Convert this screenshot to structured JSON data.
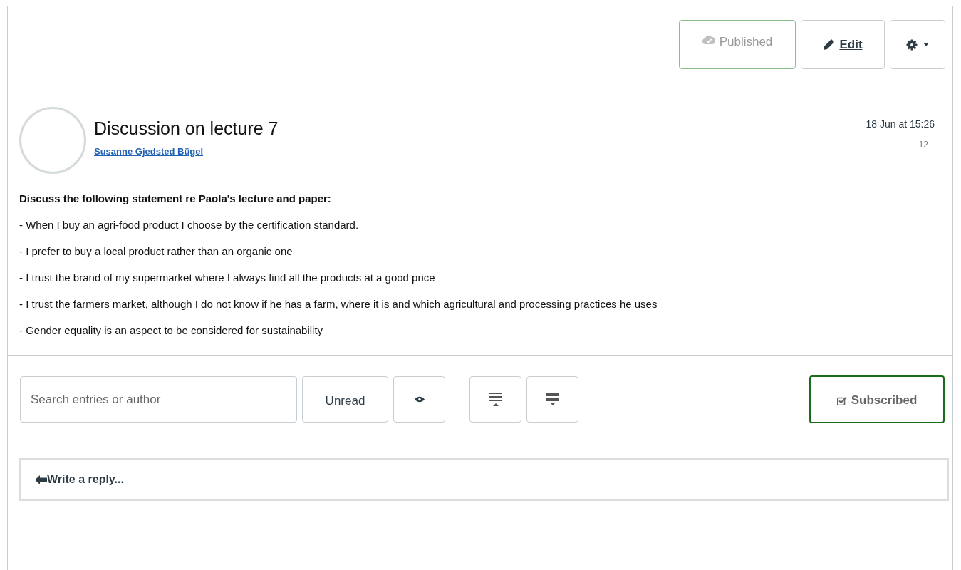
{
  "header": {
    "published": {
      "label": "Published",
      "on": true
    },
    "edit": {
      "label": "Edit"
    }
  },
  "post": {
    "title": "Discussion on lecture 7",
    "author": "Susanne Gjedsted Bügel",
    "date": "18 Jun at 15:26",
    "count": "12",
    "heading": "Discuss the following statement re Paola's lecture and paper:",
    "paragraphs": [
      "- When I buy an agri-food product I choose by the certification standard.",
      "- I prefer to buy a local product rather than an organic one",
      "- I trust the brand of my supermarket where I always find all the products at a good price",
      "- I trust the farmers market, although I do not know if he has a farm, where it is and which agricultural and processing practices he uses",
      "- Gender equality is an aspect to be considered for sustainability"
    ]
  },
  "toolbar": {
    "search": {
      "placeholder": "Search entries or author"
    },
    "unread": {
      "label": "Unread"
    },
    "subscribe": {
      "label": "Subscribed",
      "on": true
    }
  },
  "reply": {
    "label": "Write a reply..."
  }
}
